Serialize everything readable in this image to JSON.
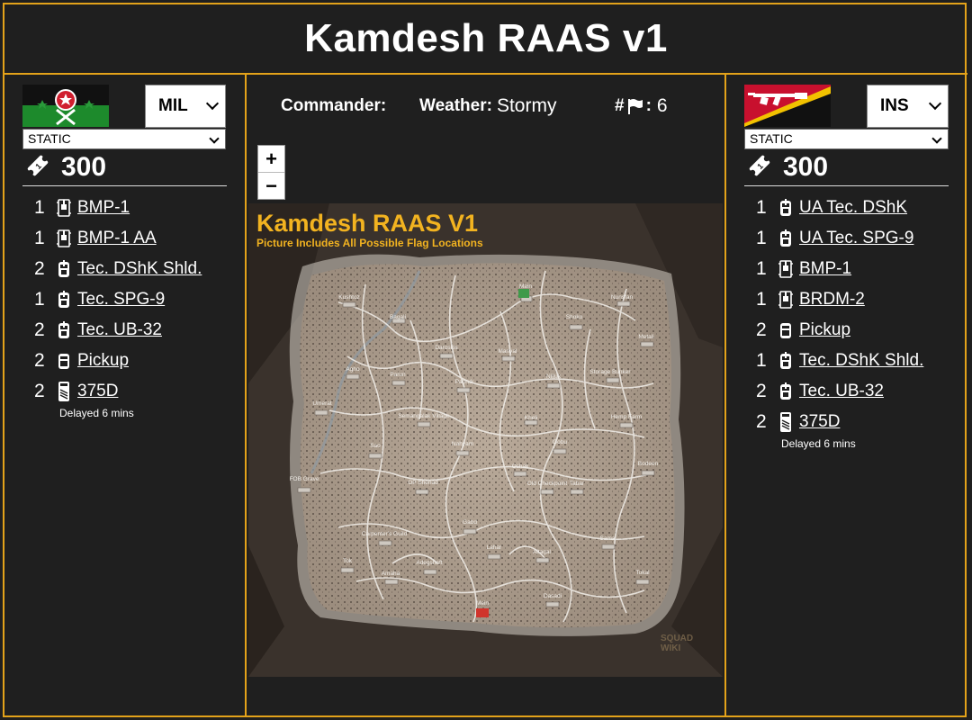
{
  "title": "Kamdesh RAAS v1",
  "left_team": {
    "faction": "MIL",
    "mode": "STATIC",
    "tickets": "300",
    "flag_colors": {
      "top": "#111111",
      "bottom": "#1d8a2c",
      "star": "#d01f2f"
    },
    "vehicles": [
      {
        "count": "1",
        "name": "BMP-1",
        "icon": "apc-icon"
      },
      {
        "count": "1",
        "name": "BMP-1 AA",
        "icon": "apc-icon"
      },
      {
        "count": "2",
        "name": "Tec. DShK Shld.",
        "icon": "technical-icon"
      },
      {
        "count": "1",
        "name": "Tec. SPG-9",
        "icon": "technical-icon"
      },
      {
        "count": "2",
        "name": "Tec. UB-32",
        "icon": "technical-icon"
      },
      {
        "count": "2",
        "name": "Pickup",
        "icon": "truck-icon"
      },
      {
        "count": "2",
        "name": "375D",
        "icon": "logistics-truck-icon"
      }
    ],
    "delayed_note": "Delayed 6 mins"
  },
  "right_team": {
    "faction": "INS",
    "mode": "STATIC",
    "tickets": "300",
    "flag_colors": {
      "top": "#c8102e",
      "bottom": "#111111",
      "stripe": "#f2c200"
    },
    "vehicles": [
      {
        "count": "1",
        "name": "UA Tec. DShK",
        "icon": "technical-icon"
      },
      {
        "count": "1",
        "name": "UA Tec. SPG-9",
        "icon": "technical-icon"
      },
      {
        "count": "1",
        "name": "BMP-1",
        "icon": "apc-icon"
      },
      {
        "count": "1",
        "name": "BRDM-2",
        "icon": "apc-icon"
      },
      {
        "count": "2",
        "name": "Pickup",
        "icon": "truck-icon"
      },
      {
        "count": "1",
        "name": "Tec. DShK Shld.",
        "icon": "technical-icon"
      },
      {
        "count": "2",
        "name": "Tec. UB-32",
        "icon": "technical-icon"
      },
      {
        "count": "2",
        "name": "375D",
        "icon": "logistics-truck-icon"
      }
    ],
    "delayed_note": "Delayed 6 mins"
  },
  "info": {
    "commander_label": "Commander:",
    "commander_value": "",
    "weather_label": "Weather:",
    "weather_value": "Stormy",
    "flags_hash": "#",
    "flags_colon": ":",
    "flags_value": "6"
  },
  "zoom": {
    "in": "+",
    "out": "−"
  },
  "map": {
    "title": "Kamdesh RAAS V1",
    "subtitle": "Picture Includes All Possible Flag Locations",
    "watermark": "SQUAD WIKI",
    "labels": [
      "Kushtoz",
      "Main",
      "Nunsfan",
      "Bagali",
      "Shoko",
      "Daroskis",
      "Manyal",
      "Metali",
      "Agho",
      "Parun",
      "Storage Bunker",
      "Nilluk",
      "Umerat",
      "Papruk",
      "Semangalak Village",
      "Kheli",
      "Hemp Farm",
      "Sao",
      "Nahyam",
      "Gobu",
      "Bodeen",
      "FOB Grave",
      "OP Shenad",
      "Oshak",
      "Old Checkpoint",
      "Tabar",
      "Carpenter's Guild",
      "Gabd",
      "Sama",
      "Tok",
      "Lahar",
      "Altagal",
      "Kegal",
      "Amaha",
      "Tokal",
      "Adegshaft",
      "Mein",
      "Dasadi"
    ]
  },
  "colors": {
    "accent": "#e3a21a",
    "background": "#1f1f1f",
    "map_yellow": "#f2b320"
  }
}
